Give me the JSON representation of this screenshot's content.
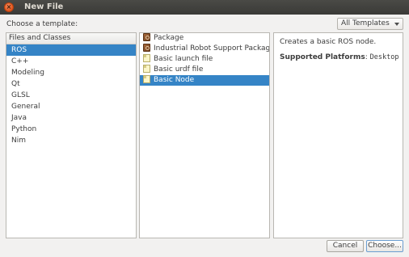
{
  "window": {
    "title": "New File",
    "close_glyph": "×"
  },
  "header": {
    "prompt": "Choose a template:",
    "template_filter": "All Templates"
  },
  "categories": {
    "header": "Files and Classes",
    "items": [
      "ROS",
      "C++",
      "Modeling",
      "Qt",
      "GLSL",
      "General",
      "Java",
      "Python",
      "Nim"
    ],
    "selected": "ROS"
  },
  "templates": {
    "items": [
      {
        "label": "Package",
        "icon": "package-icon"
      },
      {
        "label": "Industrial Robot Support Package",
        "icon": "package-icon"
      },
      {
        "label": "Basic launch file",
        "icon": "file-icon"
      },
      {
        "label": "Basic urdf file",
        "icon": "file-icon"
      },
      {
        "label": "Basic Node",
        "icon": "file-icon"
      }
    ],
    "selected": "Basic Node"
  },
  "details": {
    "description": "Creates a basic ROS node.",
    "platforms_label": "Supported Platforms",
    "platforms_sep": ":",
    "platforms_value": "Desktop"
  },
  "buttons": {
    "cancel": "Cancel",
    "choose": "Choose..."
  },
  "colors": {
    "selection": "#3584c6",
    "titlebar": "#3c3b37",
    "close_button": "#e95420"
  }
}
